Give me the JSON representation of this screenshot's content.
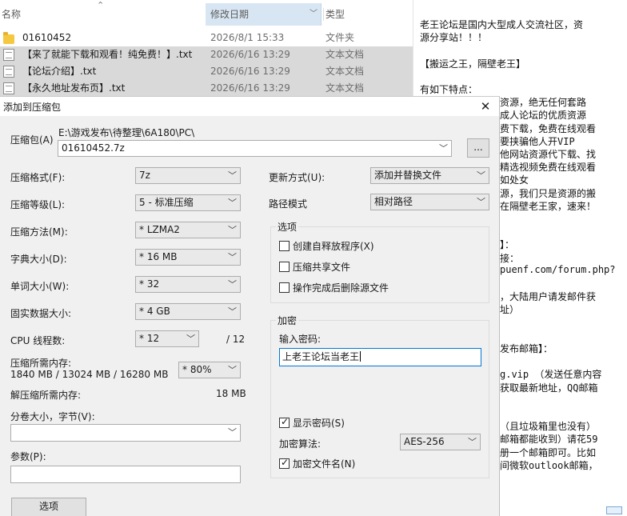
{
  "explorer": {
    "headers": {
      "name": "名称",
      "date": "修改日期",
      "type": "类型"
    },
    "files": [
      {
        "name": "01610452",
        "date": "2026/8/1 15:33",
        "type": "文件夹",
        "icon": "folder-icon",
        "selected": false
      },
      {
        "name": "【来了就能下载和观看！纯免费！】.txt",
        "date": "2026/6/16 13:29",
        "type": "文本文档",
        "icon": "text-file-icon",
        "selected": true
      },
      {
        "name": "【论坛介绍】.txt",
        "date": "2026/6/16 13:29",
        "type": "文本文档",
        "icon": "text-file-icon",
        "selected": true
      },
      {
        "name": "【永久地址发布页】.txt",
        "date": "2026/6/16 13:29",
        "type": "文本文档",
        "icon": "text-file-icon",
        "selected": true
      }
    ]
  },
  "textdoc": {
    "lines": [
      "老王论坛是国内大型成人交流社区，资",
      "源分享站！！！",
      "",
      "【搬运之王，隔壁老王】",
      "",
      "有如下特点：",
      "资源，绝无任何套路",
      "成人论坛的优质资源",
      "费下载，免费在线观看",
      "要挟骗他人开VIP",
      "他网站资源代下载、找",
      "精选视频免费在线观看",
      "如处女",
      "源，我们只是资源的搬",
      "在隔壁老王家，速来！",
      "",
      "",
      "】：",
      "接：",
      "puenf.com/forum.php?",
      "",
      "，大陆用户请发邮件获",
      "址）",
      "",
      "",
      "发布邮箱】：",
      "",
      "g.vip  （发送任意内容",
      "获取最新地址，QQ邮箱",
      "",
      "",
      "（且垃圾箱里也没有）",
      "邮箱都能收到）请花59",
      "册一个邮箱即可。比如",
      "间微软outlook邮箱，"
    ]
  },
  "dialog": {
    "title": "添加到压缩包",
    "archive": {
      "label": "压缩包(A)",
      "path": "E:\\游戏发布\\待整理\\6A180\\PC\\",
      "name": "01610452.7z",
      "browse": "..."
    },
    "left": {
      "format": {
        "label": "压缩格式(F):",
        "value": "7z"
      },
      "level": {
        "label": "压缩等级(L):",
        "value": "5 - 标准压缩"
      },
      "method": {
        "label": "压缩方法(M):",
        "value": "* LZMA2"
      },
      "dict": {
        "label": "字典大小(D):",
        "value": "* 16 MB"
      },
      "word": {
        "label": "单词大小(W):",
        "value": "* 32"
      },
      "solid": {
        "label": "固实数据大小:",
        "value": "* 4 GB"
      },
      "threads": {
        "label": "CPU 线程数:",
        "value": "* 12",
        "max": "/ 12"
      },
      "mem_compress": {
        "label": "压缩所需内存:",
        "detail": "1840 MB / 13024 MB / 16280 MB",
        "value": "* 80%"
      },
      "mem_decompress": {
        "label": "解压缩所需内存:",
        "value": "18 MB"
      },
      "split": {
        "label": "分卷大小，字节(V):",
        "value": ""
      },
      "params": {
        "label": "参数(P):",
        "value": ""
      },
      "options_button": "选项"
    },
    "right": {
      "update": {
        "label": "更新方式(U):",
        "value": "添加并替换文件"
      },
      "path_mode": {
        "label": "路径模式",
        "value": "相对路径"
      },
      "options_group": {
        "title": "选项",
        "items": [
          {
            "label": "创建自释放程序(X)",
            "checked": false
          },
          {
            "label": "压缩共享文件",
            "checked": false
          },
          {
            "label": "操作完成后删除源文件",
            "checked": false
          }
        ]
      },
      "encryption": {
        "title": "加密",
        "password_label": "输入密码:",
        "password_value": "上老王论坛当老王",
        "show_password": {
          "label": "显示密码(S)",
          "checked": true
        },
        "method_label": "加密算法:",
        "method_value": "AES-256",
        "encrypt_names": {
          "label": "加密文件名(N)",
          "checked": true
        }
      }
    }
  }
}
